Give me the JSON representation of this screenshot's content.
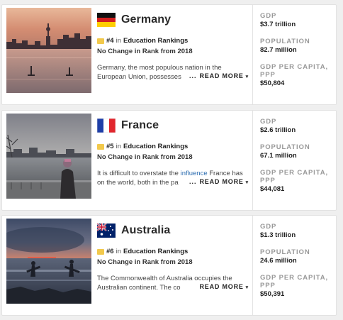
{
  "cards": [
    {
      "country": "Germany",
      "flag_icon": "germany-flag-icon",
      "rank": "#4",
      "rank_in": "in",
      "ranking_name": "Education Rankings",
      "change": "No Change in Rank from 2018",
      "desc_1": "Germany, the most populous nation in the",
      "desc_2": "European Union, possesses",
      "read_more": "READ MORE",
      "gdp_label": "GDP",
      "gdp": "$3.7 trillion",
      "pop_label": "POPULATION",
      "pop": "82.7 million",
      "pc_label": "GDP PER CAPITA, PPP",
      "pc": "$50,804"
    },
    {
      "country": "France",
      "flag_icon": "france-flag-icon",
      "rank": "#5",
      "rank_in": "in",
      "ranking_name": "Education Rankings",
      "change": "No Change in Rank from 2018",
      "desc_1a": "It is difficult to overstate the ",
      "desc_1b": "influence",
      "desc_1c": " France has",
      "desc_2": "on the world, both in the pa",
      "read_more": "READ MORE",
      "gdp_label": "GDP",
      "gdp": "$2.6 trillion",
      "pop_label": "POPULATION",
      "pop": "67.1 million",
      "pc_label": "GDP PER CAPITA, PPP",
      "pc": "$44,081"
    },
    {
      "country": "Australia",
      "flag_icon": "australia-flag-icon",
      "rank": "#6",
      "rank_in": "in",
      "ranking_name": "Education Rankings",
      "change": "No Change in Rank from 2018",
      "desc_1": "The Commonwealth of Australia occupies the",
      "desc_2": "Australian continent. The co",
      "read_more": "READ MORE",
      "gdp_label": "GDP",
      "gdp": "$1.3 trillion",
      "pop_label": "POPULATION",
      "pop": "24.6 million",
      "pc_label": "GDP PER CAPITA, PPP",
      "pc": "$50,391"
    }
  ]
}
